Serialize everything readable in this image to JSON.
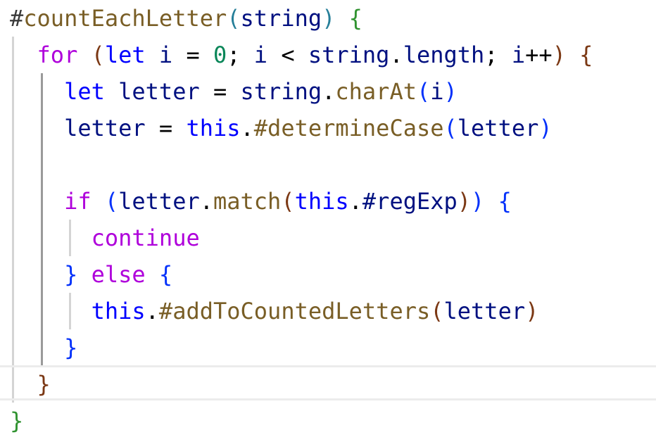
{
  "editor": {
    "language": "javascript",
    "lines": [
      {
        "tokens": [
          {
            "text": "#",
            "style": "hash"
          },
          {
            "text": "countEachLetter",
            "style": "fn"
          },
          {
            "text": "(",
            "style": "paren-1"
          },
          {
            "text": "string",
            "style": "param"
          },
          {
            "text": ")",
            "style": "paren-1"
          },
          {
            "text": " ",
            "style": "plain"
          },
          {
            "text": "{",
            "style": "brace-1"
          }
        ]
      },
      {
        "tokens": [
          {
            "text": "  ",
            "style": "plain"
          },
          {
            "text": "for",
            "style": "kw"
          },
          {
            "text": " ",
            "style": "plain"
          },
          {
            "text": "(",
            "style": "paren-2"
          },
          {
            "text": "let",
            "style": "storage"
          },
          {
            "text": " ",
            "style": "plain"
          },
          {
            "text": "i",
            "style": "var"
          },
          {
            "text": " = ",
            "style": "op"
          },
          {
            "text": "0",
            "style": "num"
          },
          {
            "text": "; ",
            "style": "punc"
          },
          {
            "text": "i",
            "style": "var"
          },
          {
            "text": " < ",
            "style": "op"
          },
          {
            "text": "string",
            "style": "var"
          },
          {
            "text": ".",
            "style": "punc"
          },
          {
            "text": "length",
            "style": "prop"
          },
          {
            "text": "; ",
            "style": "punc"
          },
          {
            "text": "i",
            "style": "var"
          },
          {
            "text": "++",
            "style": "op"
          },
          {
            "text": ")",
            "style": "paren-2"
          },
          {
            "text": " ",
            "style": "plain"
          },
          {
            "text": "{",
            "style": "brace-2"
          }
        ]
      },
      {
        "tokens": [
          {
            "text": "    ",
            "style": "plain"
          },
          {
            "text": "let",
            "style": "storage"
          },
          {
            "text": " ",
            "style": "plain"
          },
          {
            "text": "letter",
            "style": "var"
          },
          {
            "text": " = ",
            "style": "op"
          },
          {
            "text": "string",
            "style": "var"
          },
          {
            "text": ".",
            "style": "punc"
          },
          {
            "text": "charAt",
            "style": "method"
          },
          {
            "text": "(",
            "style": "paren-3"
          },
          {
            "text": "i",
            "style": "var"
          },
          {
            "text": ")",
            "style": "paren-3"
          }
        ]
      },
      {
        "tokens": [
          {
            "text": "    ",
            "style": "plain"
          },
          {
            "text": "letter",
            "style": "var"
          },
          {
            "text": " = ",
            "style": "op"
          },
          {
            "text": "this",
            "style": "this"
          },
          {
            "text": ".",
            "style": "punc"
          },
          {
            "text": "#determineCase",
            "style": "private"
          },
          {
            "text": "(",
            "style": "paren-3"
          },
          {
            "text": "letter",
            "style": "var"
          },
          {
            "text": ")",
            "style": "paren-3"
          }
        ]
      },
      {
        "tokens": []
      },
      {
        "tokens": [
          {
            "text": "    ",
            "style": "plain"
          },
          {
            "text": "if",
            "style": "kw"
          },
          {
            "text": " ",
            "style": "plain"
          },
          {
            "text": "(",
            "style": "paren-3"
          },
          {
            "text": "letter",
            "style": "var"
          },
          {
            "text": ".",
            "style": "punc"
          },
          {
            "text": "match",
            "style": "method"
          },
          {
            "text": "(",
            "style": "paren-2"
          },
          {
            "text": "this",
            "style": "this"
          },
          {
            "text": ".",
            "style": "punc"
          },
          {
            "text": "#regExp",
            "style": "var"
          },
          {
            "text": ")",
            "style": "paren-2"
          },
          {
            "text": ")",
            "style": "paren-3"
          },
          {
            "text": " ",
            "style": "plain"
          },
          {
            "text": "{",
            "style": "brace-3"
          }
        ]
      },
      {
        "tokens": [
          {
            "text": "      ",
            "style": "plain"
          },
          {
            "text": "continue",
            "style": "kw"
          }
        ]
      },
      {
        "tokens": [
          {
            "text": "    ",
            "style": "plain"
          },
          {
            "text": "}",
            "style": "brace-3"
          },
          {
            "text": " ",
            "style": "plain"
          },
          {
            "text": "else",
            "style": "kw"
          },
          {
            "text": " ",
            "style": "plain"
          },
          {
            "text": "{",
            "style": "brace-3"
          }
        ]
      },
      {
        "tokens": [
          {
            "text": "      ",
            "style": "plain"
          },
          {
            "text": "this",
            "style": "this"
          },
          {
            "text": ".",
            "style": "punc"
          },
          {
            "text": "#addToCountedLetters",
            "style": "private"
          },
          {
            "text": "(",
            "style": "paren-2"
          },
          {
            "text": "letter",
            "style": "var"
          },
          {
            "text": ")",
            "style": "paren-2"
          }
        ]
      },
      {
        "tokens": [
          {
            "text": "    ",
            "style": "plain"
          },
          {
            "text": "}",
            "style": "brace-3"
          }
        ]
      },
      {
        "tokens": [
          {
            "text": "  ",
            "style": "plain"
          },
          {
            "text": "}",
            "style": "brace-2"
          }
        ]
      },
      {
        "tokens": [
          {
            "text": "}",
            "style": "brace-1"
          }
        ]
      }
    ]
  }
}
